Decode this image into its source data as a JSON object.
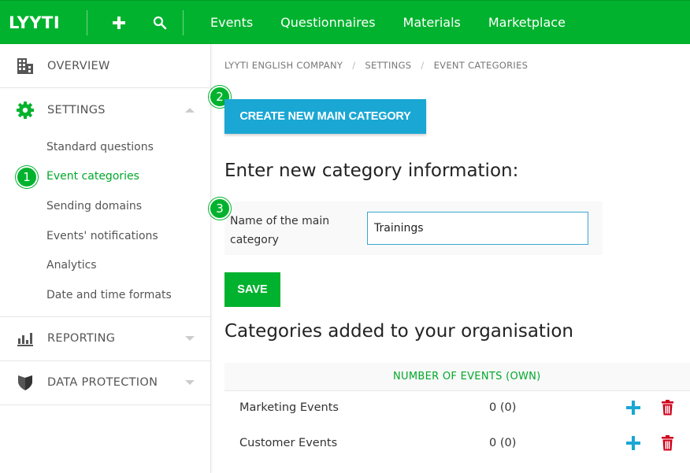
{
  "topbar": {
    "logo": "LYYTI",
    "add_icon": "plus-icon",
    "search_icon": "search-icon",
    "nav": [
      "Events",
      "Questionnaires",
      "Materials",
      "Marketplace"
    ],
    "brand_color": "#00b22d"
  },
  "sidebar": {
    "overview": {
      "label": "OVERVIEW",
      "icon": "building-icon"
    },
    "settings": {
      "label": "SETTINGS",
      "icon": "gear-icon",
      "items": [
        "Standard questions",
        "Event categories",
        "Sending domains",
        "Events' notifications",
        "Analytics",
        "Date and time formats"
      ],
      "active_index": 1
    },
    "reporting": {
      "label": "REPORTING",
      "icon": "bar-chart-icon"
    },
    "data_protection": {
      "label": "DATA PROTECTION",
      "icon": "shield-icon"
    }
  },
  "steps": [
    "1",
    "2",
    "3"
  ],
  "breadcrumb": [
    "LYYTI ENGLISH COMPANY",
    "SETTINGS",
    "EVENT CATEGORIES"
  ],
  "main": {
    "create_button": "CREATE NEW MAIN CATEGORY",
    "form_heading": "Enter new category information:",
    "name_label": "Name of the main category",
    "name_value": "Trainings",
    "save_button": "SAVE",
    "list_heading": "Categories added to your organisation"
  },
  "table": {
    "column_header": "NUMBER OF EVENTS (OWN)",
    "rows": [
      {
        "name": "Marketing Events",
        "count": "0 (0)"
      },
      {
        "name": "Customer Events",
        "count": "0 (0)"
      }
    ]
  }
}
